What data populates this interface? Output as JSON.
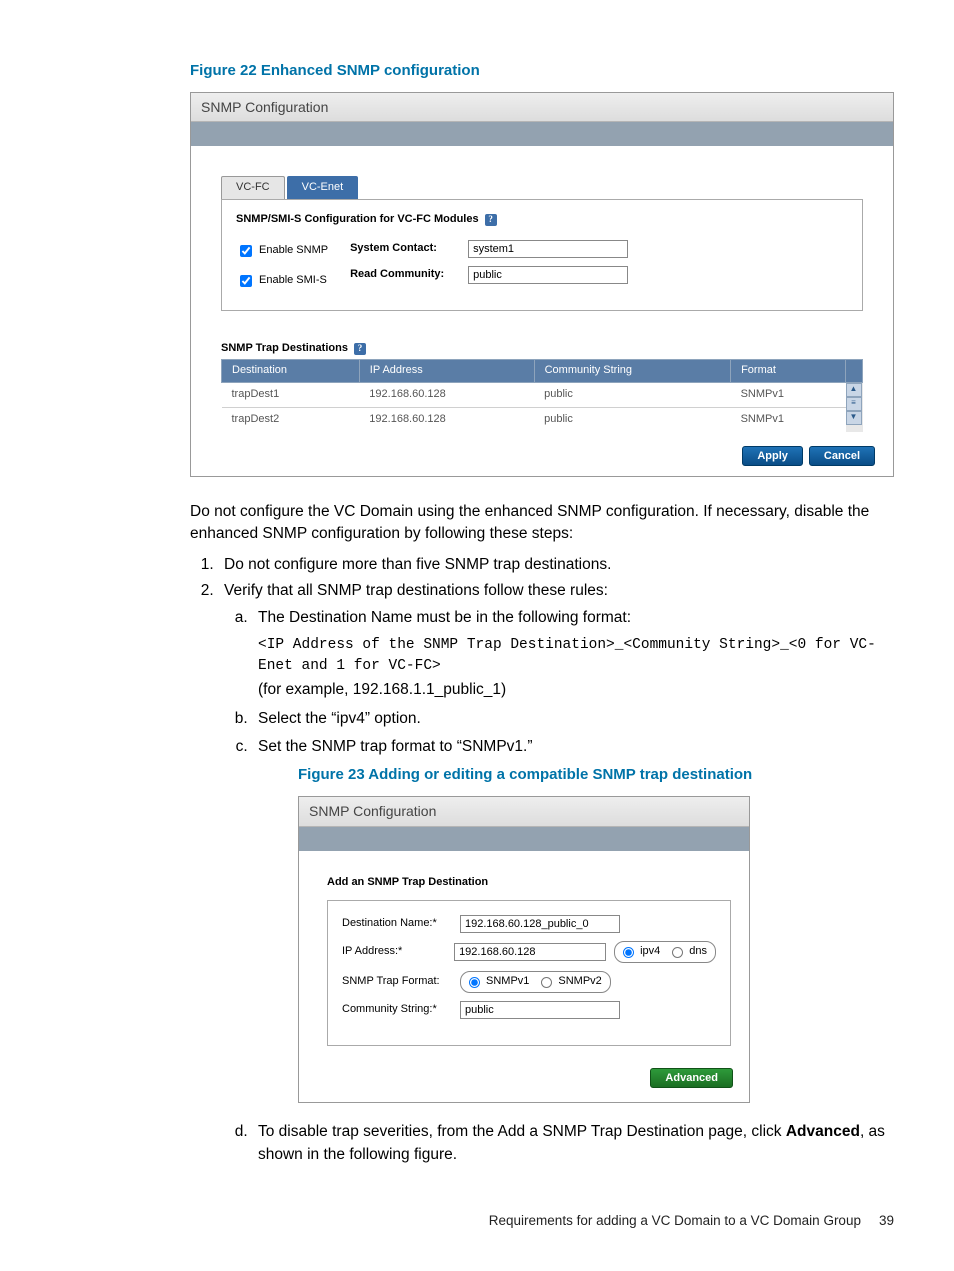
{
  "figure22_title": "Figure 22 Enhanced SNMP configuration",
  "panel1": {
    "header": "SNMP Configuration",
    "tabs": {
      "vcfc": "VC-FC",
      "vcenet": "VC-Enet",
      "active": "vcenet"
    },
    "section_title": "SNMP/SMI-S Configuration for VC-FC Modules",
    "enable_snmp_label": "Enable SNMP",
    "enable_smis_label": "Enable SMI-S",
    "system_contact_label": "System Contact:",
    "system_contact_value": "system1",
    "read_community_label": "Read Community:",
    "read_community_value": "public",
    "trap_section_title": "SNMP Trap Destinations",
    "trap_columns": {
      "dest": "Destination",
      "ip": "IP Address",
      "cs": "Community String",
      "fmt": "Format"
    },
    "trap_rows": [
      {
        "dest": "trapDest1",
        "ip": "192.168.60.128",
        "cs": "public",
        "fmt": "SNMPv1"
      },
      {
        "dest": "trapDest2",
        "ip": "192.168.60.128",
        "cs": "public",
        "fmt": "SNMPv1"
      }
    ],
    "apply_label": "Apply",
    "cancel_label": "Cancel"
  },
  "body": {
    "intro": "Do not configure the VC Domain using the enhanced SNMP configuration. If necessary, disable the enhanced SNMP configuration by following these steps:",
    "step1": "Do not configure more than five SNMP trap destinations.",
    "step2": "Verify that all SNMP trap destinations follow these rules:",
    "s2a": "The Destination Name must be in the following format:",
    "s2a_code": "<IP Address of the SNMP Trap Destination>_<Community String>_<0 for VC-Enet and 1 for VC-FC>",
    "s2a_example": "(for example, 192.168.1.1_public_1)",
    "s2b": "Select the “ipv4” option.",
    "s2c": "Set the SNMP trap format to “SNMPv1.”",
    "s2d": "To disable trap severities, from the Add a SNMP Trap Destination page, click ",
    "s2d_bold": "Advanced",
    "s2d_after": ", as shown in the following figure."
  },
  "figure23_title": "Figure 23 Adding or editing a compatible SNMP trap destination",
  "panel2": {
    "header": "SNMP Configuration",
    "box_title": "Add an SNMP Trap Destination",
    "dest_name_label": "Destination Name:*",
    "dest_name_value": "192.168.60.128_public_0",
    "ip_label": "IP Address:*",
    "ip_value": "192.168.60.128",
    "ipv4_label": "ipv4",
    "dns_label": "dns",
    "format_label": "SNMP Trap Format:",
    "snmpv1_label": "SNMPv1",
    "snmpv2_label": "SNMPv2",
    "cs_label": "Community String:*",
    "cs_value": "public",
    "advanced_label": "Advanced"
  },
  "footer": {
    "text": "Requirements for adding a VC Domain to a VC Domain Group",
    "page": "39"
  }
}
